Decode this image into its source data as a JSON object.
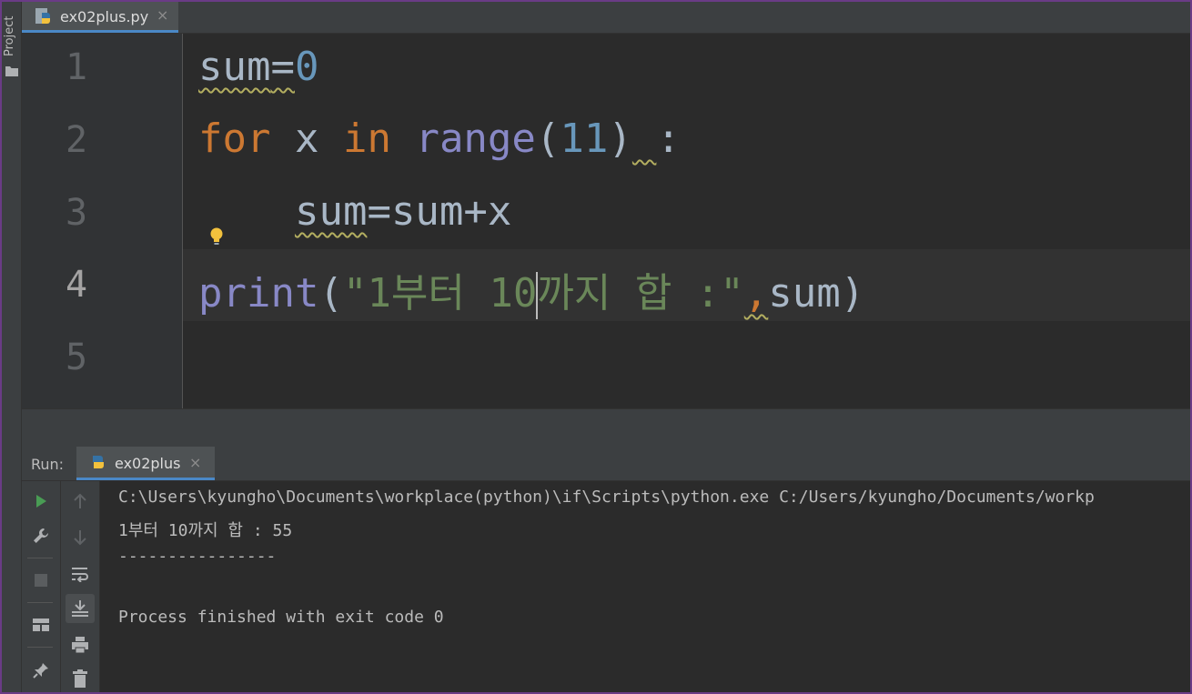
{
  "sidebar": {
    "project_label": "Project"
  },
  "editor_tab": {
    "filename": "ex02plus.py",
    "close": "×"
  },
  "gutter": {
    "lines": [
      "1",
      "2",
      "3",
      "4",
      "5"
    ]
  },
  "code": {
    "line1": {
      "a": "sum",
      "b": "=",
      "c": "0"
    },
    "line2": {
      "a": "for",
      "b": " x ",
      "c": "in",
      "d": " ",
      "e": "range",
      "f": "(",
      "g": "11",
      "h": ")",
      "i": " ",
      "j": ":"
    },
    "line3": {
      "a": "    ",
      "b": "sum",
      "c": "=sum+x"
    },
    "line4": {
      "a": "print",
      "b": "(",
      "c": "\"1부터 10",
      "d": "까지 합 :\"",
      "e": ",",
      "f": "sum",
      "g": ")"
    }
  },
  "run_panel": {
    "label": "Run:",
    "tab": "ex02plus",
    "close": "×",
    "console": [
      "C:\\Users\\kyungho\\Documents\\workplace(python)\\if\\Scripts\\python.exe C:/Users/kyungho/Documents/workp",
      "1부터 10까지 합 : 55",
      "----------------",
      "",
      "Process finished with exit code 0"
    ]
  },
  "colors": {
    "keyword": "#cc7832",
    "number": "#6897bb",
    "builtin": "#8888c6",
    "string": "#6a8759",
    "default": "#a9b7c6",
    "run_green": "#499c54"
  },
  "icons": [
    "folder-icon",
    "python-file-icon",
    "lightbulb-icon",
    "run-icon",
    "wrench-icon",
    "stop-icon",
    "layout-icon",
    "pin-icon",
    "arrow-up-icon",
    "arrow-down-icon",
    "soft-wrap-icon",
    "scroll-to-end-icon",
    "print-icon",
    "trash-icon"
  ]
}
